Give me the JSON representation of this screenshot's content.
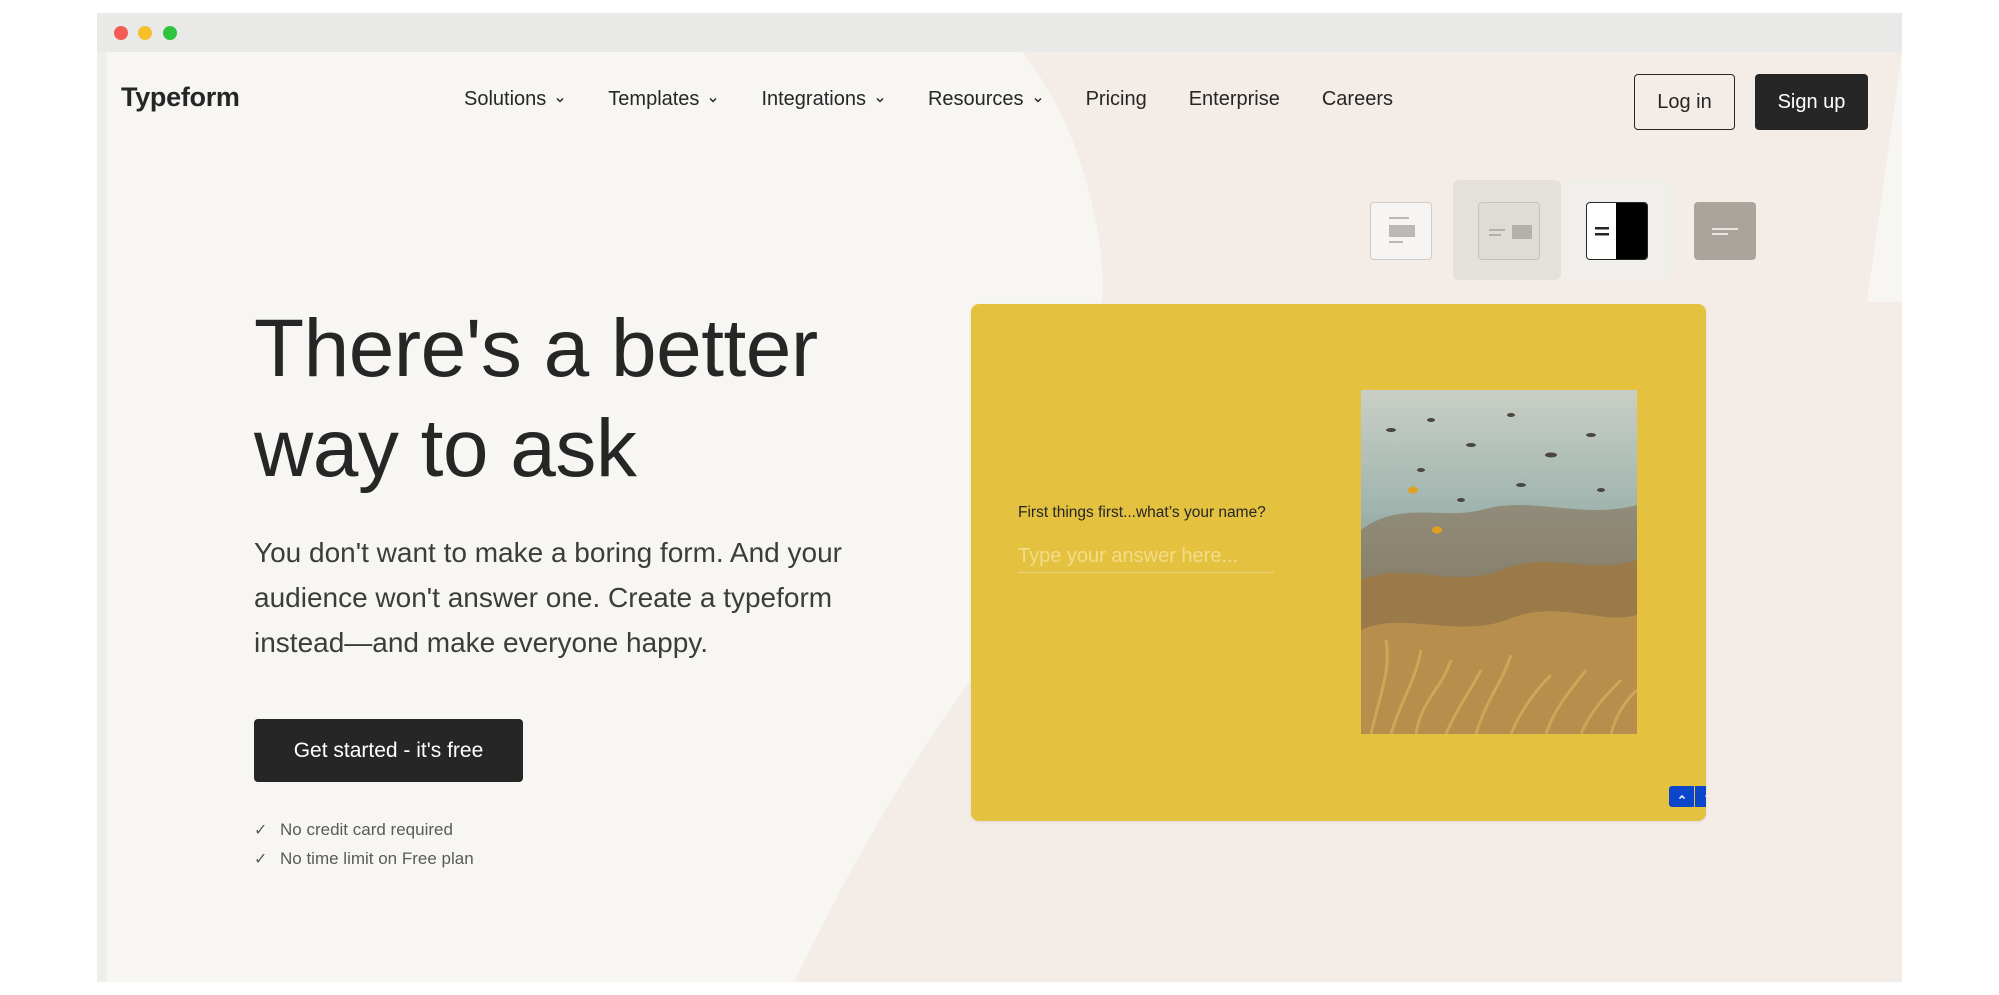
{
  "browser": {
    "controls": [
      "close",
      "minimize",
      "maximize"
    ]
  },
  "header": {
    "logo": "Typeform",
    "nav": [
      {
        "label": "Solutions",
        "dropdown": true
      },
      {
        "label": "Templates",
        "dropdown": true
      },
      {
        "label": "Integrations",
        "dropdown": true
      },
      {
        "label": "Resources",
        "dropdown": true
      },
      {
        "label": "Pricing",
        "dropdown": false
      },
      {
        "label": "Enterprise",
        "dropdown": false
      },
      {
        "label": "Careers",
        "dropdown": false
      }
    ],
    "login_label": "Log in",
    "signup_label": "Sign up"
  },
  "layout_options": {
    "icons": [
      "layout-stack-icon",
      "layout-split-icon",
      "layout-split-dark-icon",
      "layout-wallpaper-icon"
    ],
    "selected": 2
  },
  "hero": {
    "title_line1": "There's a better",
    "title_line2": "way to ask",
    "subtitle": "You don't want to make a boring form. And your audience won't answer one. Create a typeform instead—and make everyone happy.",
    "cta_label": "Get started - it's free",
    "checks": [
      "No credit card required",
      "No time limit on Free plan"
    ]
  },
  "preview": {
    "question": "First things first...what’s your name?",
    "answer_placeholder": "Type your answer here...",
    "image_icon": "coral-reef-photo",
    "nav_up_icon": "chevron-up-icon",
    "nav_down_icon": "chevron-down-icon"
  },
  "colors": {
    "card_bg": "#e4c13f",
    "primary_dark": "#262627",
    "nav_button_blue": "#0b45c9",
    "page_bg": "#f7f6f3",
    "blob_bg": "#f4ece6"
  }
}
